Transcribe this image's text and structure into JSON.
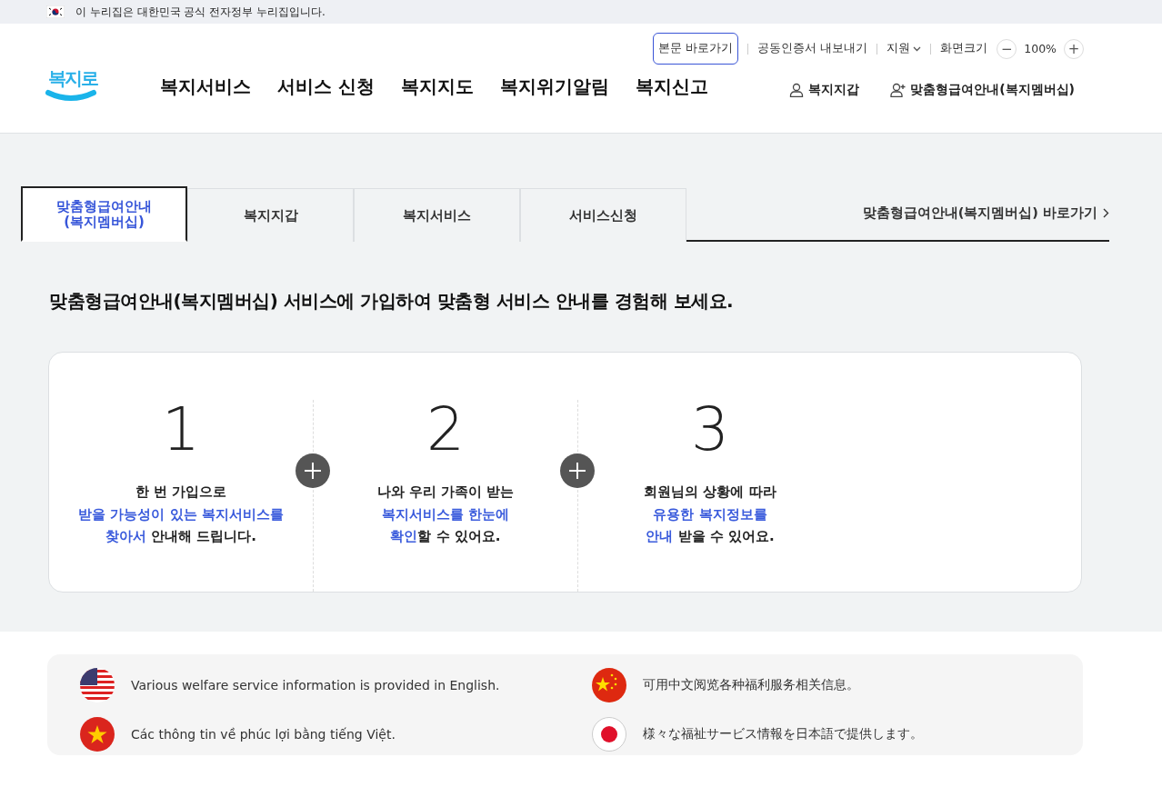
{
  "gov_banner": {
    "text": "이 누리집은 대한민국 공식 전자정부 누리집입니다."
  },
  "header": {
    "logo": "복지로",
    "utility_links": [
      {
        "label": "본문 바로가기",
        "kind": "skip"
      },
      {
        "label": "공동인증서 내보내기",
        "kind": "link"
      },
      {
        "label": "지원",
        "kind": "dropdown"
      }
    ],
    "zoom": {
      "label": "화면크기",
      "minus": "−",
      "value": "100%",
      "plus": "+"
    },
    "nav": [
      "복지서비스",
      "서비스 신청",
      "복지지도",
      "복지위기알림",
      "복지신고"
    ],
    "user_links": [
      {
        "label": "복지지갑",
        "kind": "person"
      },
      {
        "label": "맞춤형급여안내(복지멤버십)",
        "kind": "person-add"
      }
    ]
  },
  "tabs": [
    {
      "label": "맞춤형급여안내\n(복지멤버십)",
      "selected": true
    },
    {
      "label": "복지지갑",
      "selected": false
    },
    {
      "label": "복지서비스",
      "selected": false
    },
    {
      "label": "서비스신청",
      "selected": false
    }
  ],
  "shortcut": "맞춤형급여안내(복지멤버십) 바로가기",
  "headline": "맞춤형급여안내(복지멤버십) 서비스에 가입하여 맞춤형 서비스 안내를 경험해 보세요.",
  "steps": [
    {
      "number": "1",
      "lines": [
        [
          {
            "text": "한 번 가입으로",
            "accent": false
          }
        ],
        [
          {
            "text": "받을 가능성이 있는 복지서비스를",
            "accent": true
          }
        ],
        [
          {
            "text": "찾아서",
            "accent": true
          },
          {
            "text": " 안내해 드립니다.",
            "accent": false
          }
        ]
      ]
    },
    {
      "number": "2",
      "lines": [
        [
          {
            "text": "나와 우리 가족이 받는",
            "accent": false
          }
        ],
        [
          {
            "text": "복지서비스를 한눈에",
            "accent": true
          }
        ],
        [
          {
            "text": "확인",
            "accent": true
          },
          {
            "text": "할 수 있어요.",
            "accent": false
          }
        ]
      ]
    },
    {
      "number": "3",
      "lines": [
        [
          {
            "text": "회원님의 상황에 따라",
            "accent": false
          }
        ],
        [
          {
            "text": "유용한 복지정보를",
            "accent": true
          }
        ],
        [
          {
            "text": "안내",
            "accent": true
          },
          {
            "text": " 받을 수 있어요.",
            "accent": false
          }
        ]
      ]
    }
  ],
  "languages": [
    {
      "kind": "us",
      "text": "Various welfare service information is provided in English."
    },
    {
      "kind": "cn",
      "text": "可用中文阅览各种福利服务相关信息。"
    },
    {
      "kind": "vn",
      "text": "Các thông tin về phúc lợi bằng tiếng Việt."
    },
    {
      "kind": "jp",
      "text": "様々な福祉サービス情報を日本語で提供します。"
    }
  ]
}
